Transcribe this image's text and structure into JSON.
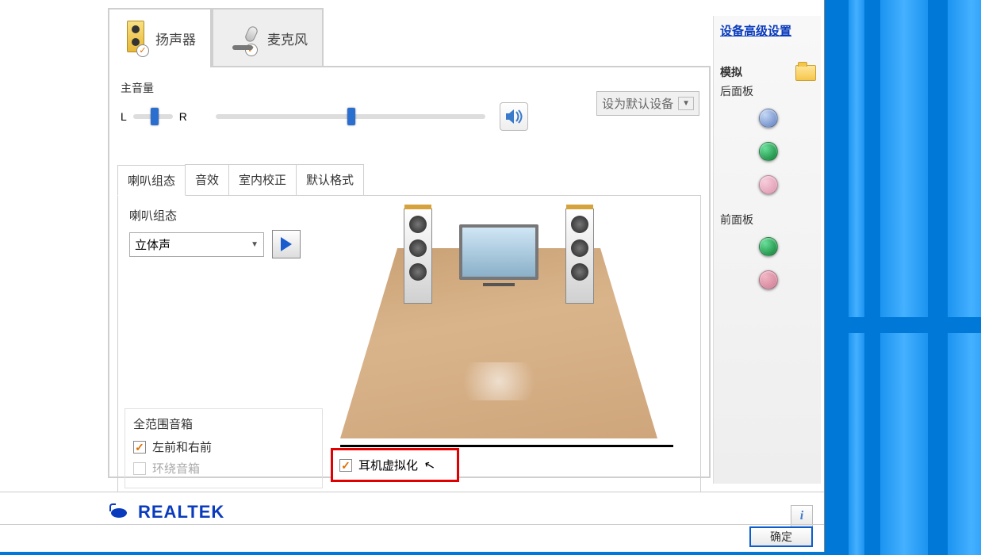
{
  "tabs": {
    "speakers": "扬声器",
    "microphone": "麦克风"
  },
  "volume": {
    "label": "主音量",
    "left": "L",
    "right": "R"
  },
  "default_device": "设为默认设备",
  "sub_tabs": {
    "config": "喇叭组态",
    "effect": "音效",
    "room": "室内校正",
    "format": "默认格式"
  },
  "speaker_config": {
    "title": "喇叭组态",
    "value": "立体声"
  },
  "full_range": {
    "title": "全范围音箱",
    "front": "左前和右前",
    "surround": "环绕音箱"
  },
  "headphone_virtual": "耳机虚拟化",
  "right_panel": {
    "advanced": "设备高级设置",
    "analog": "模拟",
    "back": "后面板",
    "front": "前面板"
  },
  "brand": "REALTEK",
  "info_label": "i",
  "ok": "确定"
}
